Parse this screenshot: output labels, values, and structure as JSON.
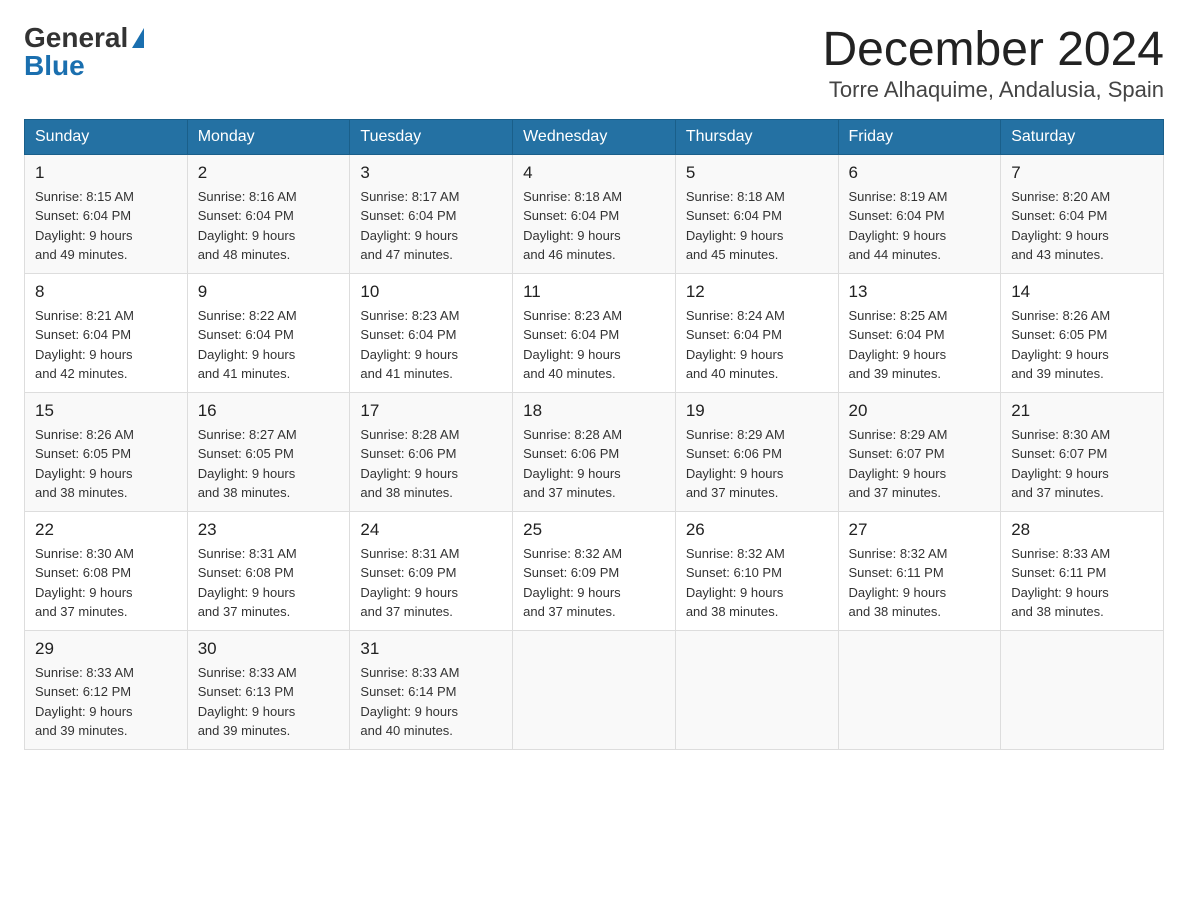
{
  "header": {
    "logo_general": "General",
    "logo_blue": "Blue",
    "month_title": "December 2024",
    "location": "Torre Alhaquime, Andalusia, Spain"
  },
  "days_of_week": [
    "Sunday",
    "Monday",
    "Tuesday",
    "Wednesday",
    "Thursday",
    "Friday",
    "Saturday"
  ],
  "weeks": [
    [
      {
        "day": "1",
        "sunrise": "8:15 AM",
        "sunset": "6:04 PM",
        "daylight_hours": "9 hours",
        "daylight_minutes": "and 49 minutes."
      },
      {
        "day": "2",
        "sunrise": "8:16 AM",
        "sunset": "6:04 PM",
        "daylight_hours": "9 hours",
        "daylight_minutes": "and 48 minutes."
      },
      {
        "day": "3",
        "sunrise": "8:17 AM",
        "sunset": "6:04 PM",
        "daylight_hours": "9 hours",
        "daylight_minutes": "and 47 minutes."
      },
      {
        "day": "4",
        "sunrise": "8:18 AM",
        "sunset": "6:04 PM",
        "daylight_hours": "9 hours",
        "daylight_minutes": "and 46 minutes."
      },
      {
        "day": "5",
        "sunrise": "8:18 AM",
        "sunset": "6:04 PM",
        "daylight_hours": "9 hours",
        "daylight_minutes": "and 45 minutes."
      },
      {
        "day": "6",
        "sunrise": "8:19 AM",
        "sunset": "6:04 PM",
        "daylight_hours": "9 hours",
        "daylight_minutes": "and 44 minutes."
      },
      {
        "day": "7",
        "sunrise": "8:20 AM",
        "sunset": "6:04 PM",
        "daylight_hours": "9 hours",
        "daylight_minutes": "and 43 minutes."
      }
    ],
    [
      {
        "day": "8",
        "sunrise": "8:21 AM",
        "sunset": "6:04 PM",
        "daylight_hours": "9 hours",
        "daylight_minutes": "and 42 minutes."
      },
      {
        "day": "9",
        "sunrise": "8:22 AM",
        "sunset": "6:04 PM",
        "daylight_hours": "9 hours",
        "daylight_minutes": "and 41 minutes."
      },
      {
        "day": "10",
        "sunrise": "8:23 AM",
        "sunset": "6:04 PM",
        "daylight_hours": "9 hours",
        "daylight_minutes": "and 41 minutes."
      },
      {
        "day": "11",
        "sunrise": "8:23 AM",
        "sunset": "6:04 PM",
        "daylight_hours": "9 hours",
        "daylight_minutes": "and 40 minutes."
      },
      {
        "day": "12",
        "sunrise": "8:24 AM",
        "sunset": "6:04 PM",
        "daylight_hours": "9 hours",
        "daylight_minutes": "and 40 minutes."
      },
      {
        "day": "13",
        "sunrise": "8:25 AM",
        "sunset": "6:04 PM",
        "daylight_hours": "9 hours",
        "daylight_minutes": "and 39 minutes."
      },
      {
        "day": "14",
        "sunrise": "8:26 AM",
        "sunset": "6:05 PM",
        "daylight_hours": "9 hours",
        "daylight_minutes": "and 39 minutes."
      }
    ],
    [
      {
        "day": "15",
        "sunrise": "8:26 AM",
        "sunset": "6:05 PM",
        "daylight_hours": "9 hours",
        "daylight_minutes": "and 38 minutes."
      },
      {
        "day": "16",
        "sunrise": "8:27 AM",
        "sunset": "6:05 PM",
        "daylight_hours": "9 hours",
        "daylight_minutes": "and 38 minutes."
      },
      {
        "day": "17",
        "sunrise": "8:28 AM",
        "sunset": "6:06 PM",
        "daylight_hours": "9 hours",
        "daylight_minutes": "and 38 minutes."
      },
      {
        "day": "18",
        "sunrise": "8:28 AM",
        "sunset": "6:06 PM",
        "daylight_hours": "9 hours",
        "daylight_minutes": "and 37 minutes."
      },
      {
        "day": "19",
        "sunrise": "8:29 AM",
        "sunset": "6:06 PM",
        "daylight_hours": "9 hours",
        "daylight_minutes": "and 37 minutes."
      },
      {
        "day": "20",
        "sunrise": "8:29 AM",
        "sunset": "6:07 PM",
        "daylight_hours": "9 hours",
        "daylight_minutes": "and 37 minutes."
      },
      {
        "day": "21",
        "sunrise": "8:30 AM",
        "sunset": "6:07 PM",
        "daylight_hours": "9 hours",
        "daylight_minutes": "and 37 minutes."
      }
    ],
    [
      {
        "day": "22",
        "sunrise": "8:30 AM",
        "sunset": "6:08 PM",
        "daylight_hours": "9 hours",
        "daylight_minutes": "and 37 minutes."
      },
      {
        "day": "23",
        "sunrise": "8:31 AM",
        "sunset": "6:08 PM",
        "daylight_hours": "9 hours",
        "daylight_minutes": "and 37 minutes."
      },
      {
        "day": "24",
        "sunrise": "8:31 AM",
        "sunset": "6:09 PM",
        "daylight_hours": "9 hours",
        "daylight_minutes": "and 37 minutes."
      },
      {
        "day": "25",
        "sunrise": "8:32 AM",
        "sunset": "6:09 PM",
        "daylight_hours": "9 hours",
        "daylight_minutes": "and 37 minutes."
      },
      {
        "day": "26",
        "sunrise": "8:32 AM",
        "sunset": "6:10 PM",
        "daylight_hours": "9 hours",
        "daylight_minutes": "and 38 minutes."
      },
      {
        "day": "27",
        "sunrise": "8:32 AM",
        "sunset": "6:11 PM",
        "daylight_hours": "9 hours",
        "daylight_minutes": "and 38 minutes."
      },
      {
        "day": "28",
        "sunrise": "8:33 AM",
        "sunset": "6:11 PM",
        "daylight_hours": "9 hours",
        "daylight_minutes": "and 38 minutes."
      }
    ],
    [
      {
        "day": "29",
        "sunrise": "8:33 AM",
        "sunset": "6:12 PM",
        "daylight_hours": "9 hours",
        "daylight_minutes": "and 39 minutes."
      },
      {
        "day": "30",
        "sunrise": "8:33 AM",
        "sunset": "6:13 PM",
        "daylight_hours": "9 hours",
        "daylight_minutes": "and 39 minutes."
      },
      {
        "day": "31",
        "sunrise": "8:33 AM",
        "sunset": "6:14 PM",
        "daylight_hours": "9 hours",
        "daylight_minutes": "and 40 minutes."
      },
      null,
      null,
      null,
      null
    ]
  ]
}
